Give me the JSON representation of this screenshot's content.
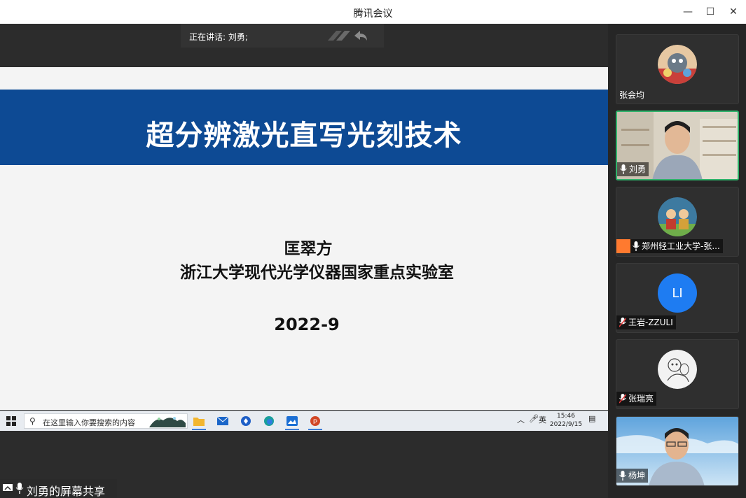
{
  "window": {
    "title": "腾讯会议",
    "minimize": "—",
    "maximize": "☐",
    "close": "✕"
  },
  "main": {
    "speaking_text": "正在讲话: 刘勇;",
    "slide": {
      "title": "超分辨激光直写光刻技术",
      "author": "匡翠方",
      "lab": "浙江大学现代光学仪器国家重点实验室",
      "date": "2022-9"
    },
    "taskbar": {
      "search_placeholder": "在这里输入你要搜索的内容",
      "ime": "英",
      "time": "15:46",
      "date": "2022/9/15"
    },
    "share_label": "刘勇的屏幕共享"
  },
  "participants": [
    {
      "name": "张会均",
      "avatar": "cartoon-avatar",
      "muted": false,
      "video": false
    },
    {
      "name": "刘勇",
      "avatar": "video",
      "muted": false,
      "video": true,
      "active": true
    },
    {
      "name": "郑州轻工业大学-张...",
      "avatar": "cartoon-avatar",
      "muted": false,
      "video": false
    },
    {
      "name": "王岩-ZZULI",
      "avatar_text": "LI",
      "muted": true,
      "video": false
    },
    {
      "name": "张瑞亮",
      "avatar": "sketch-avatar",
      "muted": true,
      "video": false
    },
    {
      "name": "杨坤",
      "avatar": "video",
      "muted": false,
      "video": true
    }
  ],
  "colors": {
    "slide_band": "#0d4a94",
    "active_border": "#2fb36b",
    "li_avatar": "#1e7cf2"
  }
}
